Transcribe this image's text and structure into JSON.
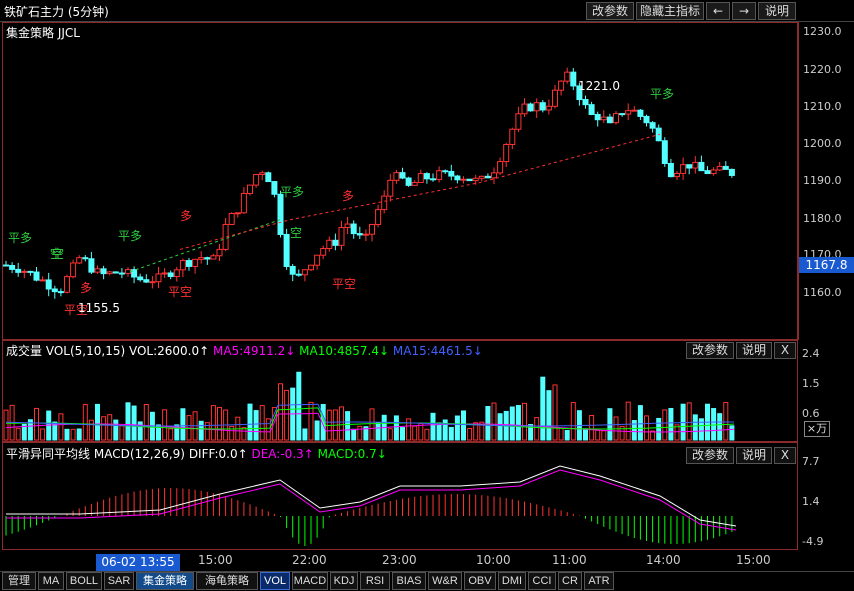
{
  "window": {
    "title": "铁矿石主力 (5分钟)"
  },
  "toolbar": {
    "change_params": "改参数",
    "hide_indicator": "隐藏主指标",
    "prev": "←",
    "next": "→",
    "help": "说明"
  },
  "main_panel": {
    "strategy_label": "集金策略 JJCL",
    "price_axis": [
      "1230.0",
      "1220.0",
      "1210.0",
      "1200.0",
      "1190.0",
      "1180.0",
      "1170.0",
      "1160.0"
    ],
    "current_price": "1167.8",
    "high_label": "1221.0",
    "low_label": "1155.5",
    "signals": [
      {
        "text": "平多",
        "color": "#2ecc40"
      },
      {
        "text": "空",
        "color": "#2ecc40"
      },
      {
        "text": "多",
        "color": "#ff3030"
      },
      {
        "text": "平空",
        "color": "#ff3030"
      },
      {
        "text": "平多",
        "color": "#2ecc40"
      },
      {
        "text": "空",
        "color": "#2ecc40"
      },
      {
        "text": "多",
        "color": "#ff3030"
      },
      {
        "text": "平空",
        "color": "#ff3030"
      },
      {
        "text": "平多",
        "color": "#2ecc40"
      },
      {
        "text": "空",
        "color": "#2ecc40"
      },
      {
        "text": "多",
        "color": "#ff3030"
      },
      {
        "text": "平空",
        "color": "#ff3030"
      },
      {
        "text": "平多",
        "color": "#2ecc40"
      }
    ]
  },
  "volume_panel": {
    "name": "成交量",
    "formula": "VOL(5,10,15)",
    "vol": "VOL:2600.0↑",
    "ma5": "MA5:4911.2↓",
    "ma10": "MA10:4857.4↓",
    "ma15": "MA15:4461.5↓",
    "axis": [
      "2.4",
      "1.5",
      "0.6"
    ],
    "unit": "×万",
    "change_params": "改参数",
    "help": "说明",
    "close": "X"
  },
  "macd_panel": {
    "name": "平滑异同平均线",
    "formula": "MACD(12,26,9)",
    "diff": "DIFF:0.0↑",
    "dea": "DEA:-0.3↑",
    "macd": "MACD:0.7↓",
    "axis": [
      "7.7",
      "1.4",
      "-4.9"
    ],
    "change_params": "改参数",
    "help": "说明",
    "close": "X"
  },
  "time_axis": {
    "current": "06-02 13:55",
    "labels": [
      "15:00",
      "22:00",
      "23:00",
      "10:00",
      "11:00",
      "14:00",
      "15:00"
    ]
  },
  "tabs": [
    "管理",
    "MA",
    "BOLL",
    "SAR",
    "集金策略",
    "海龟策略",
    "VOL",
    "MACD",
    "KDJ",
    "RSI",
    "BIAS",
    "W&R",
    "OBV",
    "DMI",
    "CCI",
    "CR",
    "ATR"
  ],
  "colors": {
    "up": "#ff3232",
    "down": "#54ffff",
    "ma5": "#ff00ff",
    "ma10": "#00ff00",
    "ma15": "#4060ff",
    "diff": "#ffffff",
    "dea": "#ff00ff"
  }
}
